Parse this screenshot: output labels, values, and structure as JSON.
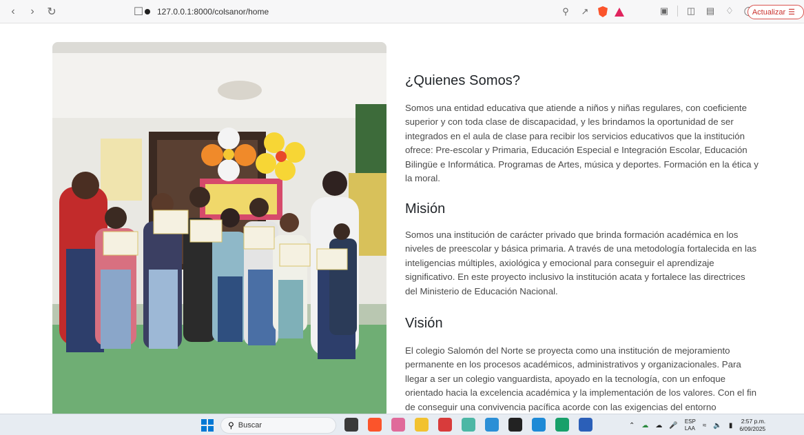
{
  "browser": {
    "url": "127.0.0.1:8000/colsanor/home",
    "update_label": "Actualizar"
  },
  "sections": {
    "about": {
      "title": "¿Quienes Somos?",
      "text": "Somos una entidad educativa que atiende a niños y niñas regulares, con coeficiente superior y con toda clase de discapacidad, y les brindamos la oportunidad de ser integrados en el aula de clase para recibir los servicios educativos que la institución ofrece: Pre-escolar y Primaria, Educación Especial e Integración Escolar, Educación Bilingüe e Informática. Programas de Artes, música y deportes. Formación en la ética y la moral."
    },
    "mission": {
      "title": "Misión",
      "text": "Somos una institución de carácter privado que brinda formación académica en los niveles de preescolar y básica primaria. A través de una metodología fortalecida en las inteligencias múltiples, axiológica y emocional para conseguir el aprendizaje significativo. En este proyecto inclusivo la institución acata y fortalece las directrices del Ministerio de Educación Nacional."
    },
    "vision": {
      "title": "Visión",
      "text": "El colegio Salomón del Norte se proyecta como una institución de mejoramiento permanente en los procesos académicos, administrativos y organizacionales. Para llegar a ser un colegio vanguardista, apoyado en la tecnología, con un enfoque orientado hacia la excelencia académica y la implementación de los valores. Con el fin de conseguir una convivencia pacífica acorde con las exigencias del entorno"
    }
  },
  "taskbar": {
    "search_label": "Buscar",
    "lang_top": "ESP",
    "lang_bottom": "LAA",
    "time": "2:57 p.m.",
    "date": "6/09/2025"
  },
  "colors": {
    "brave": "#fb542b",
    "update_red": "#c9302c",
    "windows_blue": "#0078d4"
  }
}
